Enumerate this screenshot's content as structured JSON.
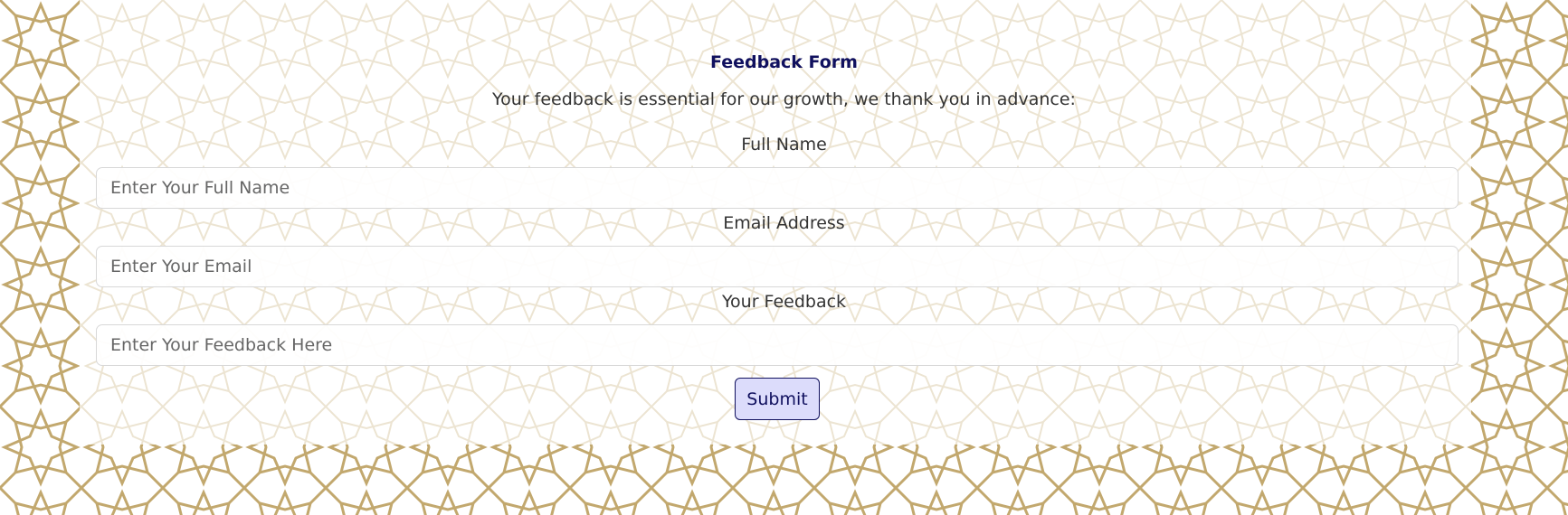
{
  "form": {
    "title": "Feedback Form",
    "subtitle": "Your feedback is essential for our growth, we thank you in advance:",
    "fields": [
      {
        "label": "Full Name",
        "placeholder": "Enter Your Full Name",
        "value": ""
      },
      {
        "label": "Email Address",
        "placeholder": "Enter Your Email",
        "value": ""
      },
      {
        "label": "Your Feedback",
        "placeholder": "Enter Your Feedback Here",
        "value": ""
      }
    ],
    "submit_label": "Submit"
  },
  "colors": {
    "title": "#10105e",
    "pattern": "#c2a86e",
    "button_bg": "#dcdcfb",
    "button_border": "#10105e"
  }
}
